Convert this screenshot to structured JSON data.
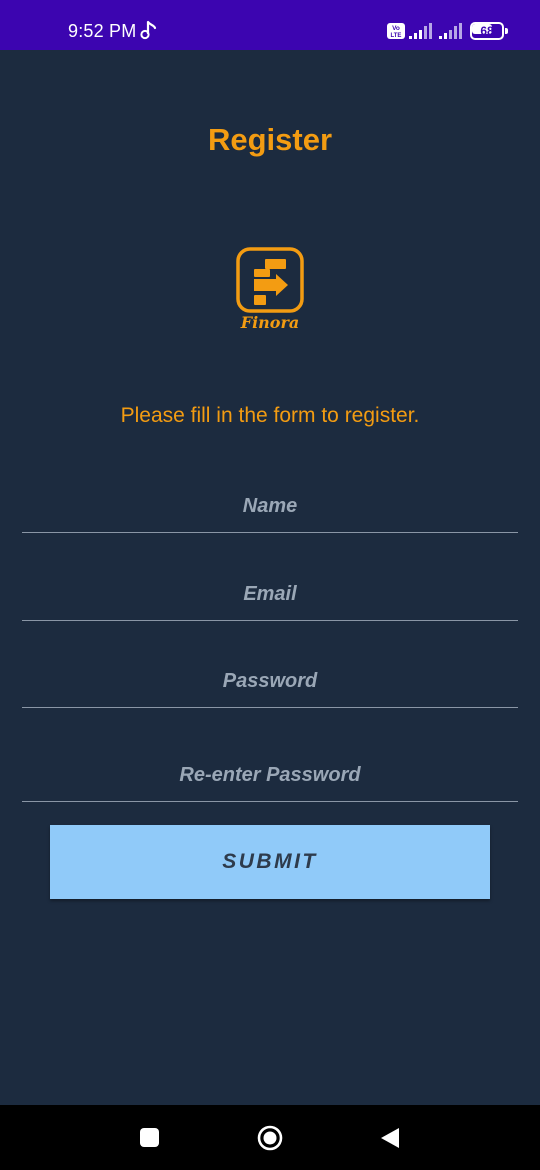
{
  "status_bar": {
    "time": "9:52 PM",
    "battery_level": "68",
    "icons": [
      "music-note-icon",
      "volte-icon",
      "signal-icon",
      "signal-icon",
      "battery-icon"
    ]
  },
  "header": {
    "title": "Register"
  },
  "logo": {
    "text": "Finora"
  },
  "form": {
    "instructions": "Please fill in the form to register.",
    "name_placeholder": "Name",
    "email_placeholder": "Email",
    "password_placeholder": "Password",
    "reenter_password_placeholder": "Re-enter Password",
    "name_value": "",
    "email_value": "",
    "password_value": "",
    "reenter_password_value": "",
    "submit_label": "SUBMIT"
  },
  "colors": {
    "background": "#1c2b3f",
    "status_bar": "#3c05b0",
    "accent": "#f39c12",
    "button": "#90caf9"
  },
  "nav_bar": {
    "icons": [
      "recents-icon",
      "home-icon",
      "back-icon"
    ]
  }
}
